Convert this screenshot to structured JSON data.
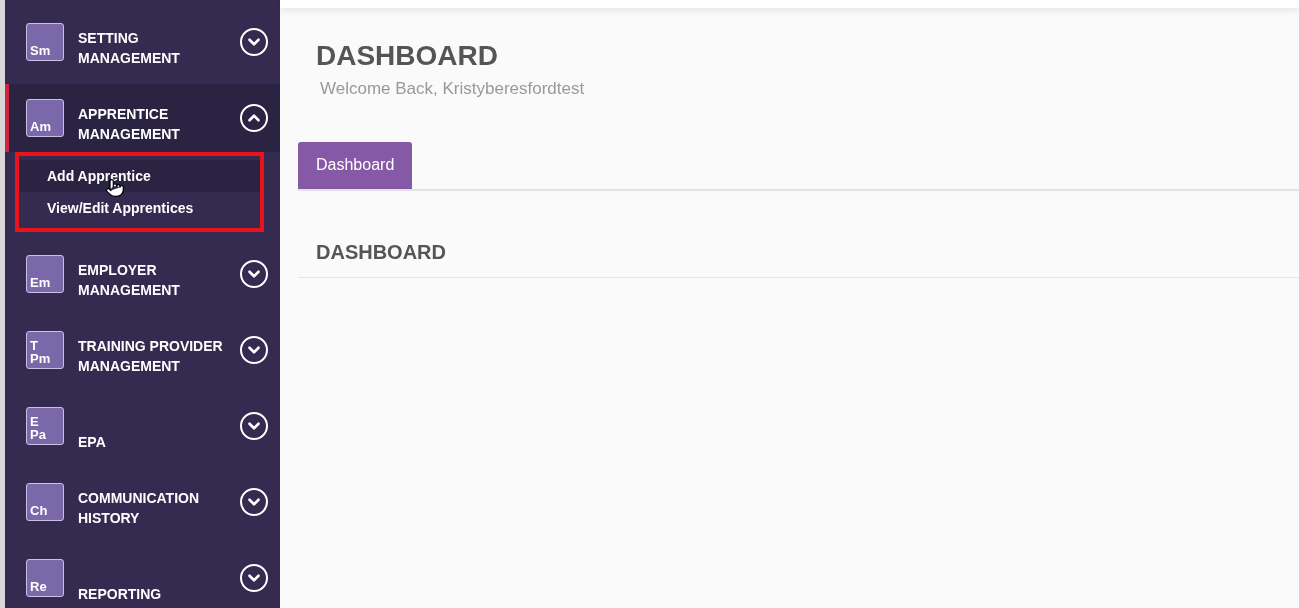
{
  "sidebar": {
    "items": [
      {
        "badge": [
          "Sm"
        ],
        "label": [
          "SETTING",
          "MANAGEMENT"
        ],
        "expanded": false,
        "active": false
      },
      {
        "badge": [
          "Am"
        ],
        "label": [
          "APPRENTICE",
          "MANAGEMENT"
        ],
        "expanded": true,
        "active": true,
        "highlighted": true,
        "children": [
          {
            "label": "Add Apprentice",
            "hovered": true
          },
          {
            "label": "View/Edit Apprentices",
            "hovered": false
          }
        ]
      },
      {
        "badge": [
          "Em"
        ],
        "label": [
          "EMPLOYER",
          "MANAGEMENT"
        ],
        "expanded": false,
        "active": false
      },
      {
        "badge": [
          "T",
          "Pm"
        ],
        "label": [
          "TRAINING PROVIDER",
          "MANAGEMENT"
        ],
        "expanded": false,
        "active": false
      },
      {
        "badge": [
          "E",
          "Pa"
        ],
        "label": [
          "EPA"
        ],
        "expanded": false,
        "active": false
      },
      {
        "badge": [
          "Ch"
        ],
        "label": [
          "COMMUNICATION",
          "HISTORY"
        ],
        "expanded": false,
        "active": false
      },
      {
        "badge": [
          "Re"
        ],
        "label": [
          "REPORTING"
        ],
        "expanded": false,
        "active": false
      }
    ]
  },
  "header": {
    "title": "DASHBOARD",
    "subtitle": "Welcome Back, Kristyberesfordtest"
  },
  "tabs": [
    {
      "label": "Dashboard",
      "selected": true
    }
  ],
  "section": {
    "title": "DASHBOARD"
  }
}
